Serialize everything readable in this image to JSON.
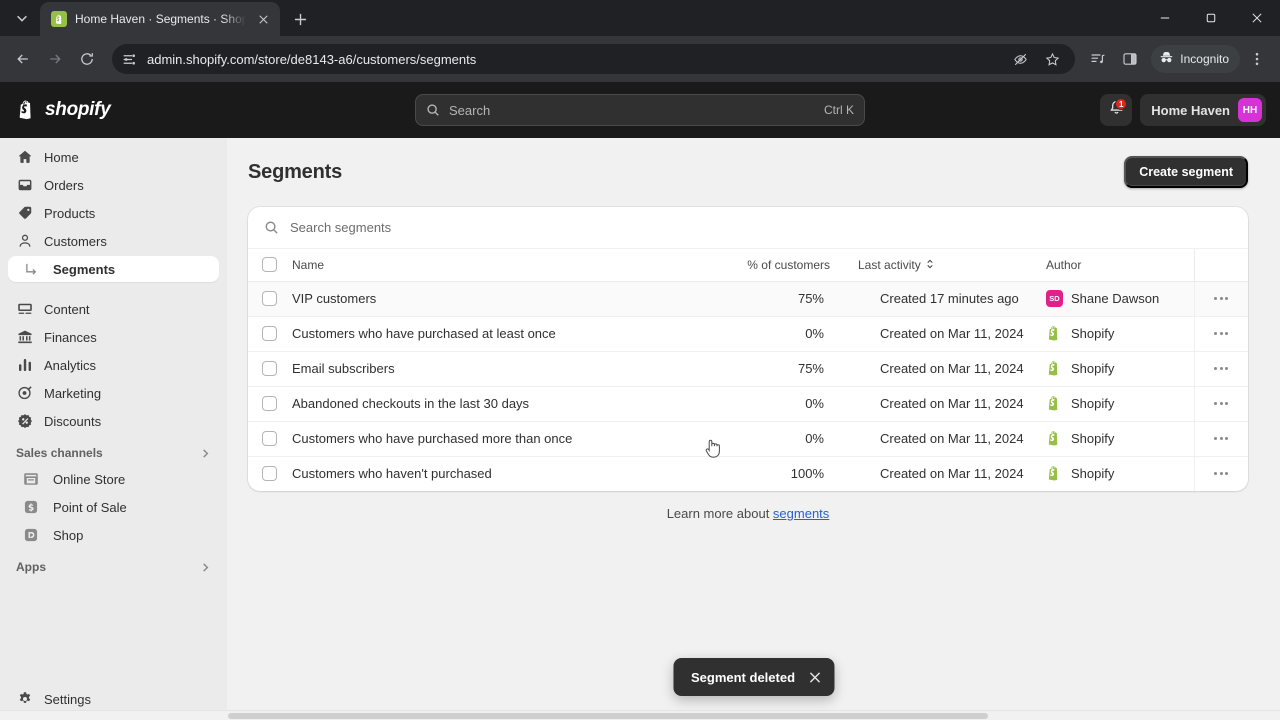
{
  "browser": {
    "tab": {
      "title": "Home Haven · Segments · Shopify",
      "favicon": "shopify-bag-icon"
    },
    "newtab_label": "+",
    "url": "admin.shopify.com/store/de8143-a6/customers/segments",
    "profile_label": "Incognito",
    "icons": {
      "tab_list": "chevron-down-icon",
      "back": "back-arrow-icon",
      "forward": "forward-arrow-icon",
      "reload": "reload-icon",
      "site_info": "page-settings-icon",
      "tracking": "eye-off-icon",
      "bookmark": "star-icon",
      "reading_list": "split-list-icon",
      "side_panel": "side-panel-icon",
      "incognito": "incognito-hat-icon",
      "menu": "three-dot-menu-icon",
      "minimize": "minimize-icon",
      "maximize": "maximize-icon",
      "close": "close-icon"
    }
  },
  "topbar": {
    "brand": "shopify",
    "search": {
      "placeholder": "Search",
      "shortcut": "Ctrl K"
    },
    "notifications_count": "1",
    "store": {
      "name": "Home Haven",
      "initials": "HH",
      "avatar_color": "#d732d7"
    }
  },
  "sidebar": {
    "items": [
      {
        "label": "Home",
        "icon": "home-icon"
      },
      {
        "label": "Orders",
        "icon": "orders-inbox-icon"
      },
      {
        "label": "Products",
        "icon": "product-tag-icon"
      },
      {
        "label": "Customers",
        "icon": "person-icon"
      },
      {
        "label": "Segments",
        "icon": "subnav-arrow-icon",
        "sub": true,
        "active": true
      },
      {
        "label": "Content",
        "icon": "content-image-icon"
      },
      {
        "label": "Finances",
        "icon": "bank-icon"
      },
      {
        "label": "Analytics",
        "icon": "bar-chart-icon"
      },
      {
        "label": "Marketing",
        "icon": "megaphone-target-icon"
      },
      {
        "label": "Discounts",
        "icon": "discount-badge-icon"
      }
    ],
    "sections": [
      {
        "label": "Sales channels",
        "items": [
          {
            "label": "Online Store",
            "icon": "storefront-icon"
          },
          {
            "label": "Point of Sale",
            "icon": "pos-icon"
          },
          {
            "label": "Shop",
            "icon": "shop-app-icon"
          }
        ]
      },
      {
        "label": "Apps",
        "items": []
      }
    ],
    "settings": {
      "label": "Settings",
      "icon": "gear-icon"
    }
  },
  "main": {
    "title": "Segments",
    "create_button": "Create segment",
    "search_placeholder": "Search segments",
    "table": {
      "columns": [
        "Name",
        "% of customers",
        "Last activity",
        "Author"
      ],
      "sorted_column": "Last activity",
      "rows": [
        {
          "name": "VIP customers",
          "pct": "75%",
          "activity": "Created 17 minutes ago",
          "author": "Shane Dawson",
          "author_initials": "SD",
          "author_avatar_color": "#e0218a",
          "author_type": "user"
        },
        {
          "name": "Customers who have purchased at least once",
          "pct": "0%",
          "activity": "Created on Mar 11, 2024",
          "author": "Shopify",
          "author_type": "shopify"
        },
        {
          "name": "Email subscribers",
          "pct": "75%",
          "activity": "Created on Mar 11, 2024",
          "author": "Shopify",
          "author_type": "shopify"
        },
        {
          "name": "Abandoned checkouts in the last 30 days",
          "pct": "0%",
          "activity": "Created on Mar 11, 2024",
          "author": "Shopify",
          "author_type": "shopify"
        },
        {
          "name": "Customers who have purchased more than once",
          "pct": "0%",
          "activity": "Created on Mar 11, 2024",
          "author": "Shopify",
          "author_type": "shopify"
        },
        {
          "name": "Customers who haven't purchased",
          "pct": "100%",
          "activity": "Created on Mar 11, 2024",
          "author": "Shopify",
          "author_type": "shopify"
        }
      ]
    },
    "learn_more": {
      "prefix": "Learn more about ",
      "link": "segments"
    }
  },
  "toast": {
    "message": "Segment deleted",
    "close": "close-icon"
  }
}
